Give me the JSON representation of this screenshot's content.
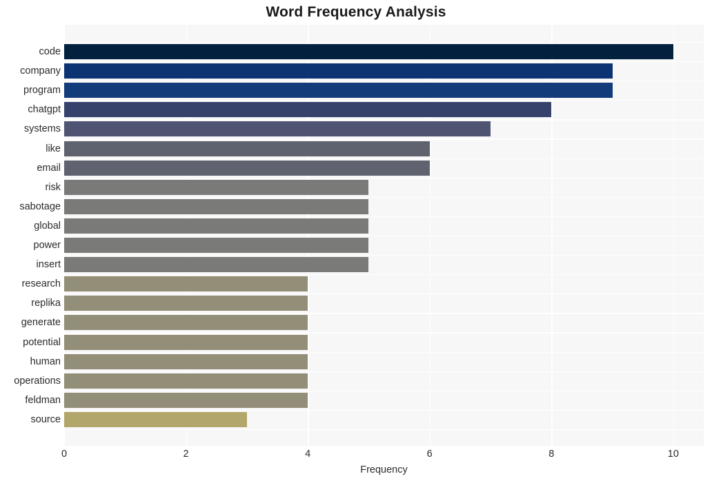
{
  "chart_data": {
    "type": "bar",
    "orientation": "horizontal",
    "title": "Word Frequency Analysis",
    "xlabel": "Frequency",
    "ylabel": "",
    "xlim": [
      0,
      10.5
    ],
    "xticks": [
      0,
      2,
      4,
      6,
      8,
      10
    ],
    "xticklabels": [
      "0",
      "2",
      "4",
      "6",
      "8",
      "10"
    ],
    "grid": true,
    "legend": null,
    "categories": [
      "code",
      "company",
      "program",
      "chatgpt",
      "systems",
      "like",
      "email",
      "risk",
      "sabotage",
      "global",
      "power",
      "insert",
      "research",
      "replika",
      "generate",
      "potential",
      "human",
      "operations",
      "feldman",
      "source"
    ],
    "values": [
      10,
      9,
      9,
      8,
      7,
      6,
      6,
      5,
      5,
      5,
      5,
      5,
      4,
      4,
      4,
      4,
      4,
      4,
      4,
      3
    ],
    "bar_colors": [
      "#04203f",
      "#0d3472",
      "#123c7a",
      "#36426b",
      "#4e5471",
      "#5f6370",
      "#5f6370",
      "#7a7a78",
      "#7a7a78",
      "#7a7a78",
      "#7a7a78",
      "#7a7a78",
      "#938e77",
      "#938e77",
      "#938e77",
      "#938e77",
      "#938e77",
      "#938e77",
      "#938e77",
      "#b2a66b"
    ],
    "plot_background": "#f7f7f7",
    "grid_color": "#ffffff",
    "figure_background": "#ffffff"
  }
}
